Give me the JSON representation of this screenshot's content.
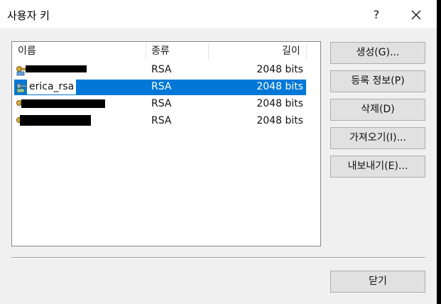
{
  "dialog": {
    "title": "사용자 키",
    "help_label": "?"
  },
  "list": {
    "columns": [
      "이름",
      "종류",
      "길이"
    ],
    "rows": [
      {
        "name": "",
        "type": "RSA",
        "size": "2048 bits",
        "selected": false
      },
      {
        "name": "erica_rsa",
        "type": "RSA",
        "size": "2048 bits",
        "selected": true
      },
      {
        "name": "",
        "type": "RSA",
        "size": "2048 bits",
        "selected": false
      },
      {
        "name": "",
        "type": "RSA",
        "size": "2048 bits",
        "selected": false
      }
    ]
  },
  "buttons": {
    "generate": "생성(G)...",
    "properties": "등록 정보(P)",
    "delete": "삭제(D)",
    "import": "가져오기(I)...",
    "export": "내보내기(E)...",
    "close": "닫기"
  },
  "colors": {
    "selection": "#0078d7",
    "dialog_bg": "#f0f0f0",
    "button_bg": "#e1e1e1"
  },
  "icons": {
    "key": "key-icon",
    "close": "close-icon"
  }
}
